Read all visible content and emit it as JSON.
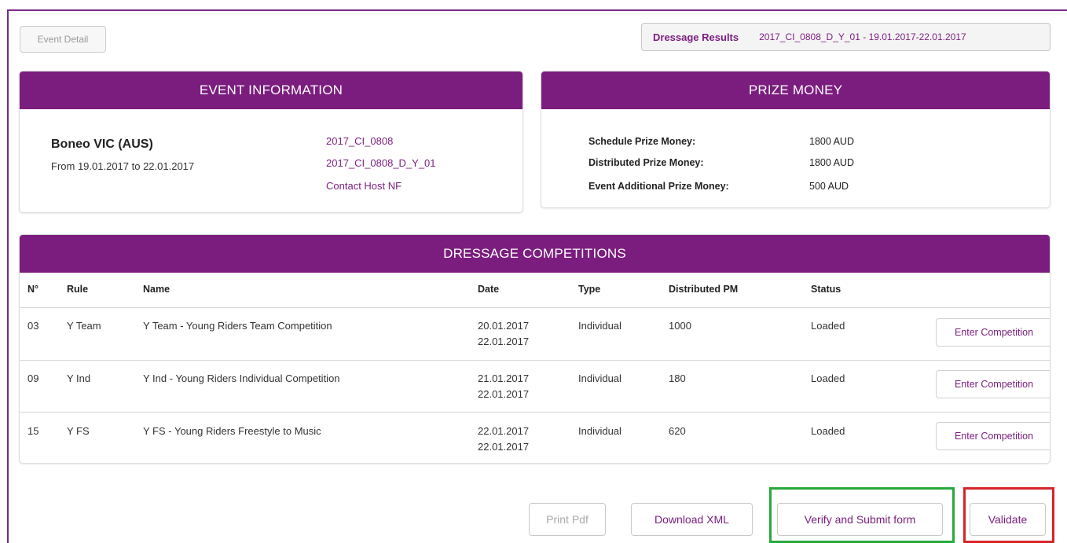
{
  "toolbar": {
    "event_detail_label": "Event Detail",
    "results_label": "Dressage Results",
    "results_value": "2017_CI_0808_D_Y_01 - 19.01.2017-22.01.2017"
  },
  "event_info": {
    "title": "EVENT INFORMATION",
    "venue": "Boneo VIC (AUS)",
    "dates": "From 19.01.2017 to 22.01.2017",
    "event_code": "2017_CI_0808",
    "competition_code": "2017_CI_0808_D_Y_01",
    "contact_link": "Contact Host NF"
  },
  "prize_money": {
    "title": "PRIZE MONEY",
    "items": [
      {
        "label": "Schedule Prize Money:",
        "value": "1800 AUD"
      },
      {
        "label": "Distributed Prize Money:",
        "value": "1800 AUD"
      },
      {
        "label": "Event Additional Prize Money:",
        "value": "500 AUD"
      }
    ]
  },
  "competitions": {
    "title": "DRESSAGE COMPETITIONS",
    "headers": {
      "no": "N°",
      "rule": "Rule",
      "name": "Name",
      "date": "Date",
      "type": "Type",
      "dist": "Distributed PM",
      "status": "Status"
    },
    "rows": [
      {
        "no": "03",
        "rule": "Y Team",
        "name": "Y Team - Young Riders Team Competition",
        "date_start": "20.01.2017",
        "date_end": "22.01.2017",
        "type": "Individual",
        "dist": "1000",
        "status": "Loaded",
        "action": "Enter Competition"
      },
      {
        "no": "09",
        "rule": "Y Ind",
        "name": "Y Ind - Young Riders Individual Competition",
        "date_start": "21.01.2017",
        "date_end": "22.01.2017",
        "type": "Individual",
        "dist": "180",
        "status": "Loaded",
        "action": "Enter Competition"
      },
      {
        "no": "15",
        "rule": "Y FS",
        "name": "Y FS - Young Riders Freestyle to Music",
        "date_start": "22.01.2017",
        "date_end": "22.01.2017",
        "type": "Individual",
        "dist": "620",
        "status": "Loaded",
        "action": "Enter Competition"
      }
    ]
  },
  "actions": {
    "print_pdf": "Print Pdf",
    "download_xml": "Download XML",
    "verify_submit": "Verify and Submit form",
    "validate": "Validate"
  },
  "colors": {
    "brand_purple": "#7b1d7f",
    "highlight_green": "#27a83c",
    "highlight_red": "#d8232a"
  }
}
